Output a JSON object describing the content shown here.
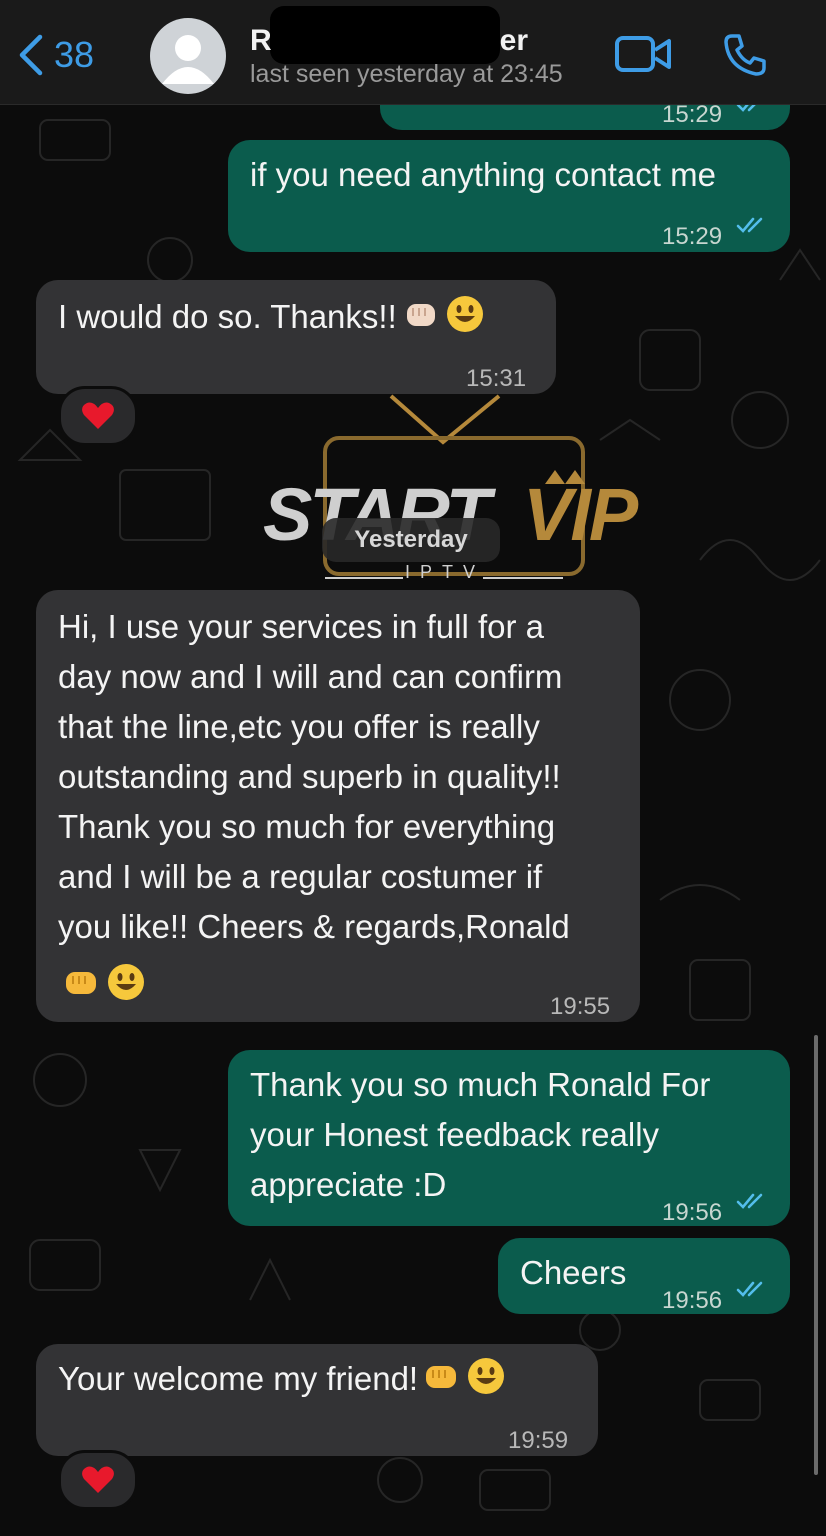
{
  "header": {
    "back_count": "38",
    "contact_name_start": "R",
    "contact_name_end": "er",
    "last_seen": "last seen yesterday at 23:45"
  },
  "messages": [
    {
      "id": "m0",
      "dir": "out",
      "text": "",
      "time": "15:29"
    },
    {
      "id": "m1",
      "dir": "out",
      "text": "if you need anything contact me",
      "time": "15:29"
    },
    {
      "id": "m2",
      "dir": "in",
      "text": "I would do so. Thanks!!",
      "time": "15:31",
      "reaction": "heart"
    },
    {
      "id": "m3",
      "dir": "in",
      "text": "Hi, I use your services in full for a\nday now and I will and can confirm\nthat the line,etc you offer is really\noutstanding and superb in quality!!\nThank you so much for everything\nand I will be a regular costumer if\nyou like!! Cheers & regards,Ronald",
      "time": "19:55"
    },
    {
      "id": "m4",
      "dir": "out",
      "text": "Thank you so much Ronald For\nyour Honest feedback really\nappreciate :D",
      "time": "19:56"
    },
    {
      "id": "m5",
      "dir": "out",
      "text": "Cheers",
      "time": "19:56"
    },
    {
      "id": "m6",
      "dir": "in",
      "text": "Your welcome my friend!",
      "time": "19:59",
      "reaction": "heart"
    }
  ],
  "date_separator": "Yesterday",
  "watermark": {
    "start": "START",
    "vip": "VIP",
    "sub": "IPTV"
  },
  "colors": {
    "outgoing": "#0b5c4d",
    "incoming": "#333335",
    "accent": "#3e9ce6",
    "read_ticks": "#53bdeb"
  }
}
